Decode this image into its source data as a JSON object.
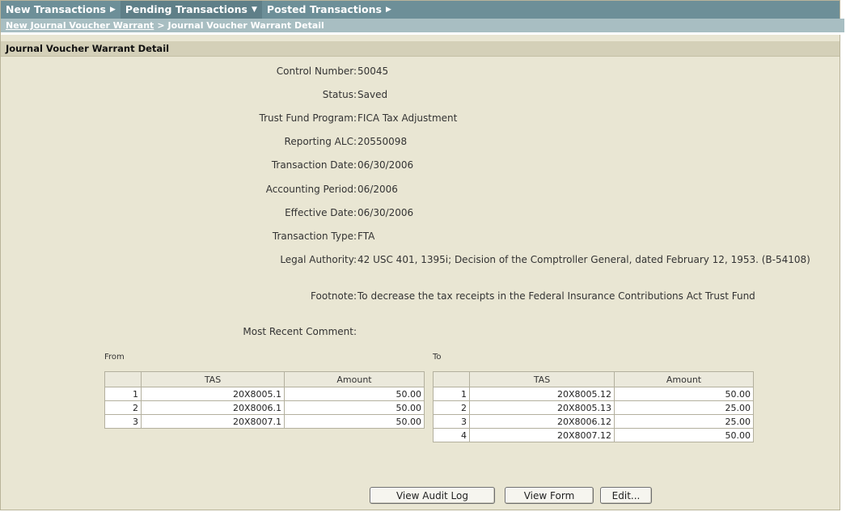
{
  "topnav": {
    "items": [
      {
        "label": "New Transactions",
        "arrow": "▶"
      },
      {
        "label": "Pending Transactions",
        "arrow": "▼"
      },
      {
        "label": "Posted Transactions",
        "arrow": "▶"
      }
    ]
  },
  "breadcrumb": {
    "link": "New Journal Voucher Warrant",
    "separator": ">",
    "current": "Journal Voucher Warrant Detail"
  },
  "section_title": "Journal Voucher Warrant Detail",
  "fields": [
    {
      "label": "Control Number:",
      "value": "50045"
    },
    {
      "label": "Status:",
      "value": "Saved"
    },
    {
      "label": "Trust Fund Program:",
      "value": "FICA Tax Adjustment"
    },
    {
      "label": "Reporting ALC:",
      "value": "20550098"
    },
    {
      "label": "Transaction Date:",
      "value": "06/30/2006"
    },
    {
      "label": "Accounting Period:",
      "value": "06/2006"
    },
    {
      "label": "Effective Date:",
      "value": "06/30/2006"
    },
    {
      "label": "Transaction Type:",
      "value": "FTA"
    },
    {
      "label": "Legal Authority:",
      "value": "42 USC 401, 1395i; Decision of the Comptroller General, dated February 12, 1953. (B-54108)"
    },
    {
      "label": "Footnote:",
      "value": "To decrease the tax receipts in the Federal Insurance Contributions Act Trust Fund"
    },
    {
      "label": "Most Recent Comment:",
      "value": ""
    }
  ],
  "from_table": {
    "label": "From",
    "headers": [
      "",
      "TAS",
      "Amount"
    ],
    "rows": [
      {
        "num": "1",
        "tas": "20X8005.1",
        "amount": "50.00"
      },
      {
        "num": "2",
        "tas": "20X8006.1",
        "amount": "50.00"
      },
      {
        "num": "3",
        "tas": "20X8007.1",
        "amount": "50.00"
      }
    ]
  },
  "to_table": {
    "label": "To",
    "headers": [
      "",
      "TAS",
      "Amount"
    ],
    "rows": [
      {
        "num": "1",
        "tas": "20X8005.12",
        "amount": "50.00"
      },
      {
        "num": "2",
        "tas": "20X8005.13",
        "amount": "25.00"
      },
      {
        "num": "3",
        "tas": "20X8006.12",
        "amount": "25.00"
      },
      {
        "num": "4",
        "tas": "20X8007.12",
        "amount": "50.00"
      }
    ]
  },
  "buttons": {
    "audit_log": "View Audit Log",
    "view_form": "View Form",
    "edit": "Edit..."
  }
}
